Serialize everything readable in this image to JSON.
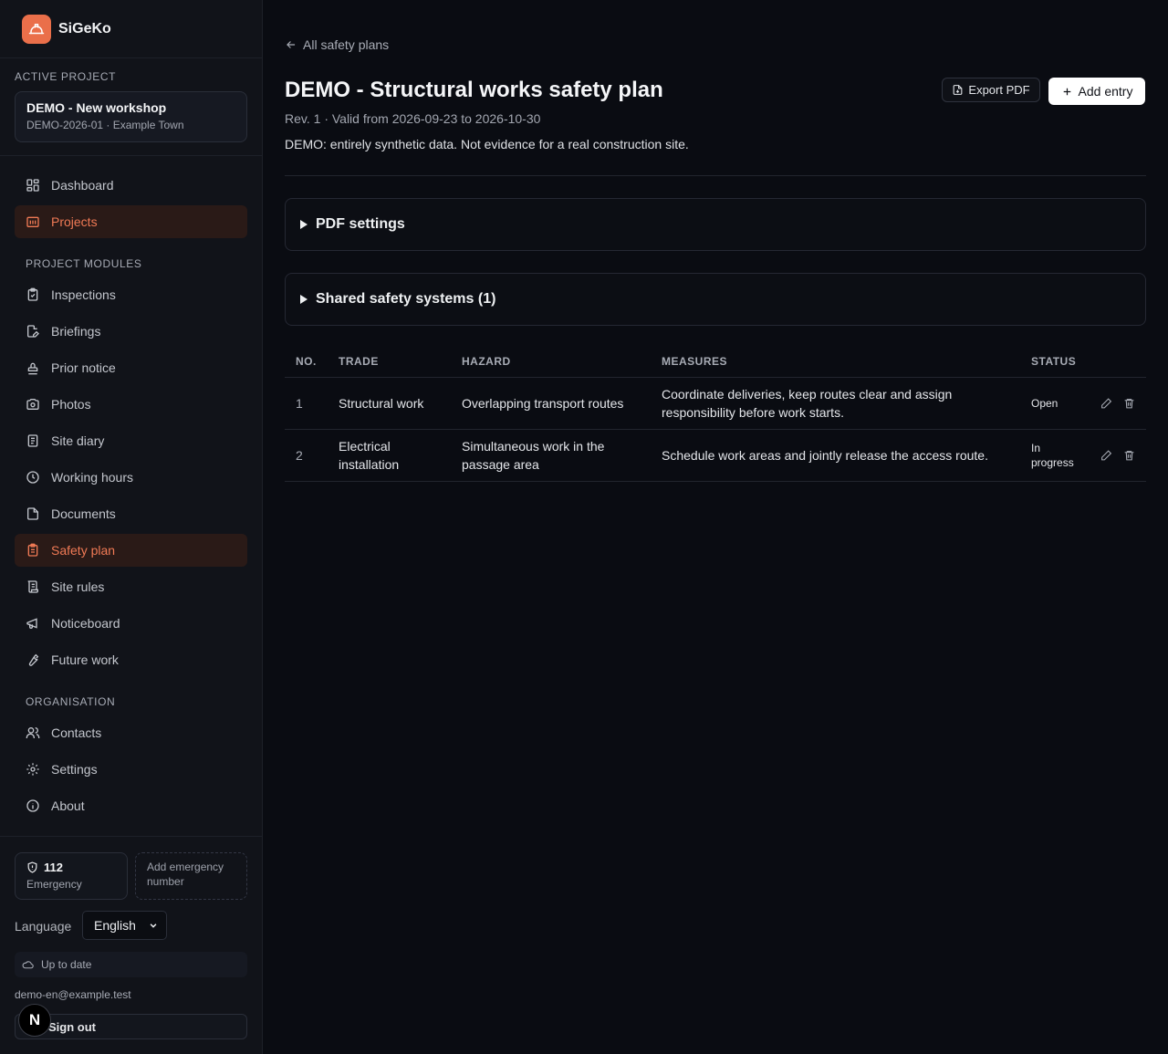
{
  "app": {
    "name": "SiGeKo",
    "brand_color": "#ea6f4a"
  },
  "sidebar": {
    "active_project_label": "ACTIVE PROJECT",
    "project": {
      "name": "DEMO - New workshop",
      "meta": "DEMO-2026-01 · Example Town"
    },
    "top_items": [
      {
        "label": "Dashboard",
        "icon": "dashboard-icon"
      },
      {
        "label": "Projects",
        "icon": "projects-icon",
        "active": true
      }
    ],
    "modules_label": "PROJECT MODULES",
    "modules": [
      {
        "label": "Inspections",
        "icon": "clipboard-check-icon"
      },
      {
        "label": "Briefings",
        "icon": "file-edit-icon"
      },
      {
        "label": "Prior notice",
        "icon": "stamp-icon"
      },
      {
        "label": "Photos",
        "icon": "camera-icon"
      },
      {
        "label": "Site diary",
        "icon": "notebook-icon"
      },
      {
        "label": "Working hours",
        "icon": "clock-icon"
      },
      {
        "label": "Documents",
        "icon": "document-icon"
      },
      {
        "label": "Safety plan",
        "icon": "clipboard-list-icon",
        "active": true
      },
      {
        "label": "Site rules",
        "icon": "scroll-icon"
      },
      {
        "label": "Noticeboard",
        "icon": "megaphone-icon"
      },
      {
        "label": "Future work",
        "icon": "wrench-icon"
      }
    ],
    "organisation_label": "ORGANISATION",
    "organisation": [
      {
        "label": "Contacts",
        "icon": "users-icon"
      },
      {
        "label": "Settings",
        "icon": "gear-icon"
      },
      {
        "label": "About",
        "icon": "info-icon"
      }
    ],
    "emergency": {
      "number": "112",
      "label": "Emergency"
    },
    "add_emergency": "Add emergency number",
    "language_label": "Language",
    "language_value": "English",
    "sync_status": "Up to date",
    "user_email": "demo-en@example.test",
    "sign_out": "Sign out",
    "next_badge": "N"
  },
  "main": {
    "back_link": "All safety plans",
    "title": "DEMO - Structural works safety plan",
    "meta": "Rev. 1 · Valid from 2026-09-23 to 2026-10-30",
    "note": "DEMO: entirely synthetic data. Not evidence for a real construction site.",
    "export_label": "Export PDF",
    "add_label": "Add entry",
    "sections": [
      {
        "label": "PDF settings"
      },
      {
        "label": "Shared safety systems (1)"
      }
    ],
    "table": {
      "headers": [
        "NO.",
        "TRADE",
        "HAZARD",
        "MEASURES",
        "STATUS"
      ],
      "rows": [
        {
          "no": "1",
          "trade": "Structural work",
          "hazard": "Overlapping transport routes",
          "measures": "Coordinate deliveries, keep routes clear and assign responsibility before work starts.",
          "status": "Open"
        },
        {
          "no": "2",
          "trade": "Electrical installation",
          "hazard": "Simultaneous work in the passage area",
          "measures": "Schedule work areas and jointly release the access route.",
          "status": "In progress"
        }
      ]
    }
  }
}
